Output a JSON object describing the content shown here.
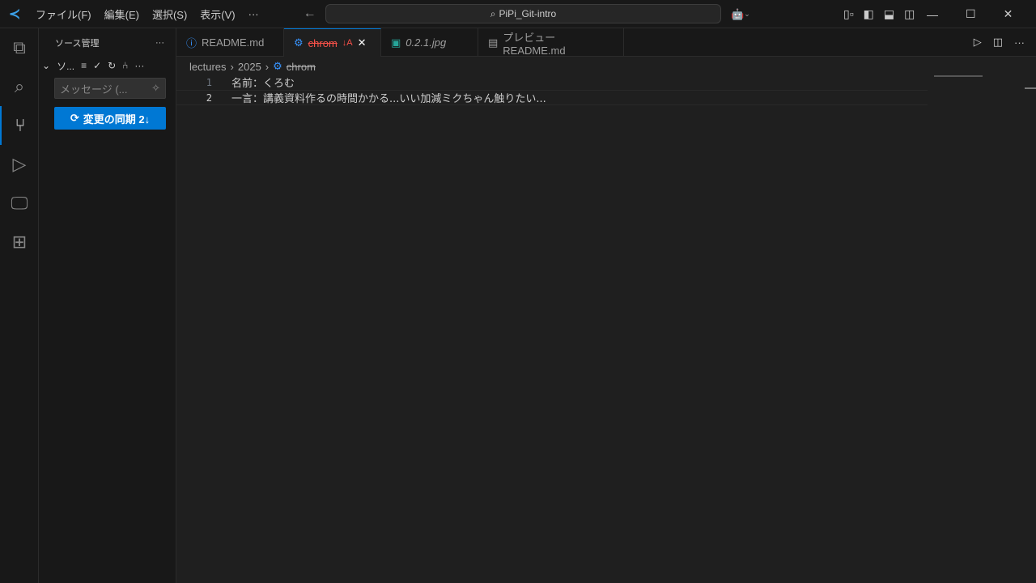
{
  "titlebar": {
    "menus": [
      "ファイル(F)",
      "編集(E)",
      "選択(S)",
      "表示(V)",
      "···"
    ],
    "search": "PiPi_Git-intro"
  },
  "sidebar": {
    "title": "ソース管理",
    "section": "ソ...",
    "message_placeholder": "メッセージ (...",
    "sync_label": "変更の同期 2↓"
  },
  "tabs": [
    {
      "label": "README.md",
      "icon": "info-icon"
    },
    {
      "label": "chrom",
      "badge": "↓A",
      "icon": "gear-icon",
      "active": true
    },
    {
      "label": "0.2.1.jpg",
      "icon": "image-icon"
    },
    {
      "label": "プレビュー README.md",
      "icon": "preview-icon"
    }
  ],
  "breadcrumb": [
    "lectures",
    "2025",
    "chrom"
  ],
  "editor": {
    "lines": [
      {
        "n": "1",
        "text": "名前：くろむ"
      },
      {
        "n": "2",
        "text": "一言：講義資料作るの時間かかる...いい加減ミクちゃん触りたい..."
      }
    ]
  },
  "colors": {
    "accent": "#0078d4",
    "deleted": "#f85149"
  }
}
